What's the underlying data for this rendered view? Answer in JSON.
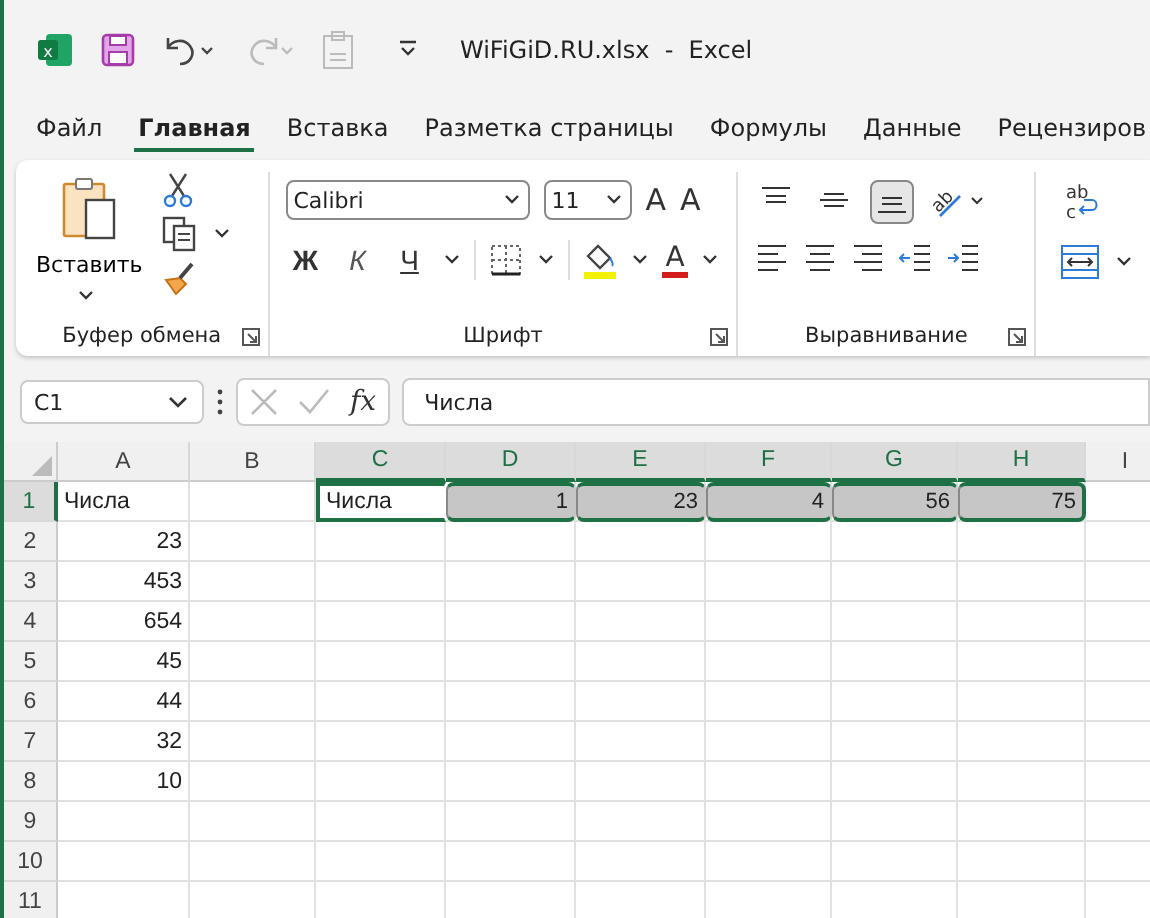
{
  "window": {
    "app_icon_letter": "x",
    "title": "WiFiGiD.RU.xlsx  -  Excel"
  },
  "tabs": [
    {
      "label": "Файл",
      "selected": false
    },
    {
      "label": "Главная",
      "selected": true
    },
    {
      "label": "Вставка",
      "selected": false
    },
    {
      "label": "Разметка страницы",
      "selected": false
    },
    {
      "label": "Формулы",
      "selected": false
    },
    {
      "label": "Данные",
      "selected": false
    },
    {
      "label": "Рецензиров",
      "selected": false
    }
  ],
  "ribbon": {
    "groups": [
      {
        "kind": "clipboard",
        "label": "Буфер обмена",
        "paste_label": "Вставить"
      },
      {
        "kind": "font",
        "label": "Шрифт",
        "font_name": "Calibri",
        "font_size": "11",
        "grow_label": "A",
        "shrink_label": "A",
        "style_buttons": [
          "Ж",
          "К",
          "Ч"
        ],
        "color_label": "A"
      },
      {
        "kind": "alignment",
        "label": "Выравнивание",
        "orientation_glyph": "ab",
        "vertical_align": [
          {
            "selected": false
          },
          {
            "selected": false
          },
          {
            "selected": true
          }
        ]
      },
      {
        "kind": "wrap",
        "wrap_glyphs": [
          "ab",
          "c"
        ]
      }
    ]
  },
  "formula_bar": {
    "name_box": "C1",
    "fx": "fx",
    "formula": "Числа"
  },
  "sheet": {
    "columns": [
      {
        "label": "A",
        "selected": false
      },
      {
        "label": "B",
        "selected": false
      },
      {
        "label": "C",
        "selected": true
      },
      {
        "label": "D",
        "selected": true
      },
      {
        "label": "E",
        "selected": true
      },
      {
        "label": "F",
        "selected": true
      },
      {
        "label": "G",
        "selected": true
      },
      {
        "label": "H",
        "selected": true
      },
      {
        "label": "I",
        "selected": false
      }
    ],
    "rows": [
      {
        "label": "1",
        "selected": true,
        "cells": [
          {
            "text": "Числа",
            "kind": "text",
            "selected": false
          },
          {
            "text": ""
          },
          {
            "text": "Числа",
            "kind": "text",
            "selected": true
          },
          {
            "text": "1",
            "kind": "number",
            "selected": true
          },
          {
            "text": "23",
            "kind": "number",
            "selected": true
          },
          {
            "text": "4",
            "kind": "number",
            "selected": true
          },
          {
            "text": "56",
            "kind": "number",
            "selected": true
          },
          {
            "text": "75",
            "kind": "number",
            "selected": true
          }
        ]
      },
      {
        "label": "2",
        "selected": false,
        "cells": [
          {
            "text": "23",
            "kind": "number",
            "selected": false
          }
        ]
      },
      {
        "label": "3",
        "selected": false,
        "cells": [
          {
            "text": "453",
            "kind": "number",
            "selected": false
          }
        ]
      },
      {
        "label": "4",
        "selected": false,
        "cells": [
          {
            "text": "654",
            "kind": "number",
            "selected": false
          }
        ]
      },
      {
        "label": "5",
        "selected": false,
        "cells": [
          {
            "text": "45",
            "kind": "number",
            "selected": false
          }
        ]
      },
      {
        "label": "6",
        "selected": false,
        "cells": [
          {
            "text": "44",
            "kind": "number",
            "selected": false
          }
        ]
      },
      {
        "label": "7",
        "selected": false,
        "cells": [
          {
            "text": "32",
            "kind": "number",
            "selected": false
          }
        ]
      },
      {
        "label": "8",
        "selected": false,
        "cells": [
          {
            "text": "10",
            "kind": "number",
            "selected": false
          }
        ]
      },
      {
        "label": "9",
        "selected": false,
        "cells": []
      },
      {
        "label": "10",
        "selected": false,
        "cells": []
      },
      {
        "label": "11",
        "selected": false,
        "cells": []
      }
    ]
  }
}
